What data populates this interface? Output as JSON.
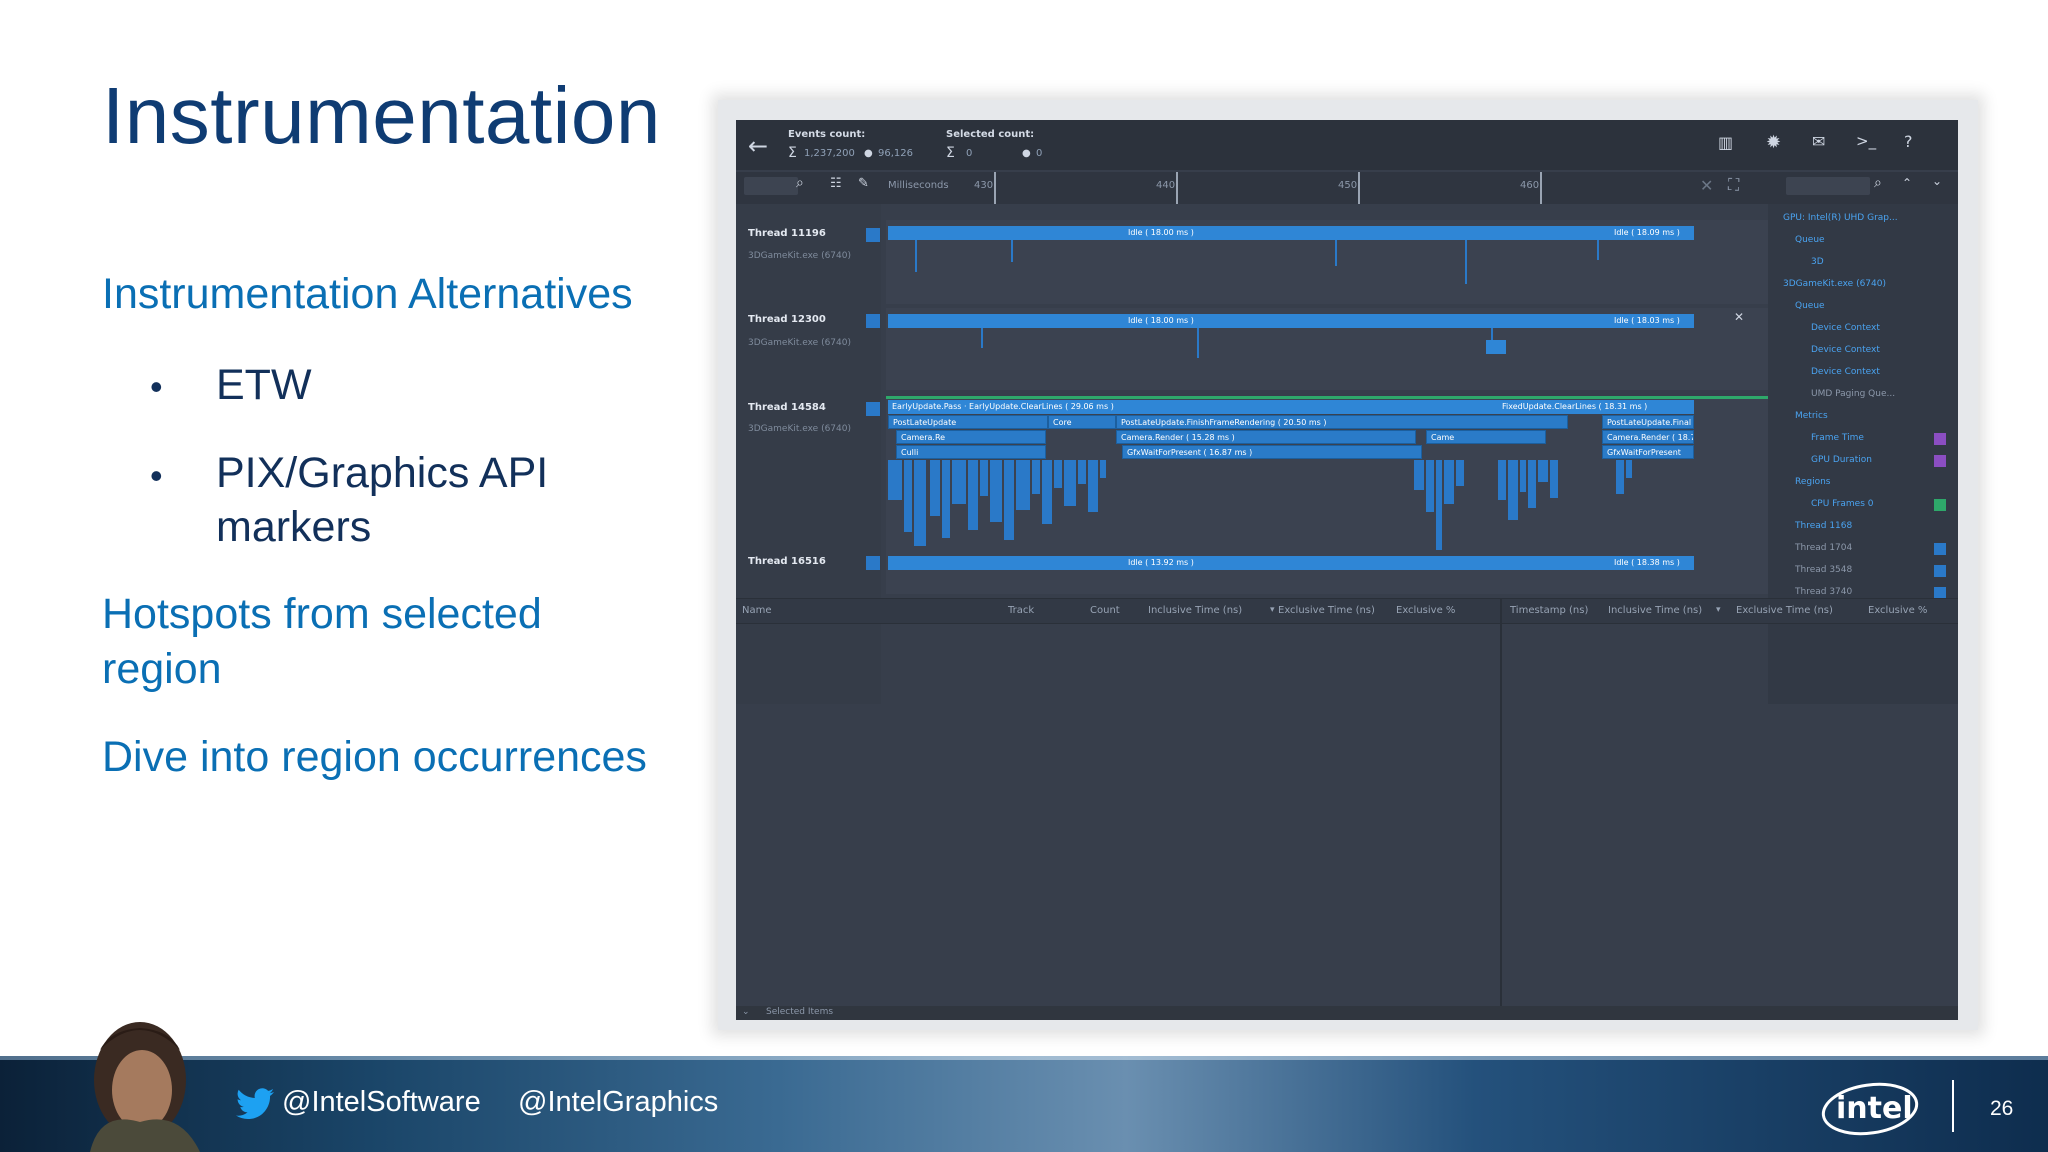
{
  "slide": {
    "title": "Instrumentation",
    "bullets": [
      {
        "text": "Instrumentation Alternatives"
      },
      {
        "text": "ETW",
        "level": 2
      },
      {
        "text": "PIX/Graphics API",
        "level": 2,
        "cont": "markers"
      },
      {
        "text": "Hotspots from selected"
      },
      {
        "text": "region"
      },
      {
        "text": "Dive into region occurrences"
      }
    ],
    "bullet_glyph": "•"
  },
  "app": {
    "toolbar": {
      "events_count_label": "Events count:",
      "events_count_value": "1,237,200",
      "events_hidden_value": "96,126",
      "selected_count_label": "Selected count:",
      "selected_count_value": "0",
      "selected_hidden_value": "0",
      "sigma": "Σ"
    },
    "ruler": {
      "unit_label": "Milliseconds",
      "ticks": [
        "430",
        "440",
        "450",
        "460"
      ]
    },
    "threads": [
      {
        "name": "Thread 11196",
        "process": "3DGameKit.exe (6740)",
        "bar_left": "Idle ( 18.00 ms )",
        "bar_right": "Idle ( 18.09 ms )"
      },
      {
        "name": "Thread 12300",
        "process": "3DGameKit.exe (6740)",
        "bar_left": "Idle ( 18.00 ms )",
        "bar_right": "Idle ( 18.03 ms )"
      },
      {
        "name": "Thread 14584",
        "process": "3DGameKit.exe (6740)",
        "bar_left": "EarlyUpdate.Pass · EarlyUpdate.ClearLines ( 29.06 ms )",
        "bar_right": "FixedUpdate.ClearLines ( 18.31 ms )",
        "sub1_a": "PostLateUpdate",
        "sub1_b": "Core",
        "sub1_c": "PostLateUpdate.FinishFrameRendering ( 20.50 ms )",
        "sub1_d": "PostLateUpdate.Final",
        "sub2_a": "Camera.Re",
        "sub2_b": "Camera.Render ( 15.28 ms )",
        "sub2_c": "Came",
        "sub2_d": "Camera.Render ( 18.7",
        "sub3_a": "Culli",
        "sub3_b": "GfxWaitForPresent ( 16.87 ms )",
        "sub3_c": "GfxWaitForPresent"
      },
      {
        "name": "Thread 16516",
        "process": "",
        "bar_left": "Idle ( 13.92 ms )",
        "bar_right": "Idle ( 18.38 ms )"
      }
    ],
    "tree": [
      {
        "label": "GPU: Intel(R) UHD Grap...",
        "indent": 0,
        "color": "#4aa3f0"
      },
      {
        "label": "Queue",
        "indent": 1,
        "color": "#4aa3f0"
      },
      {
        "label": "3D",
        "indent": 2,
        "color": "#4aa3f0"
      },
      {
        "label": "3DGameKit.exe (6740)",
        "indent": 0,
        "color": "#4aa3f0"
      },
      {
        "label": "Queue",
        "indent": 1,
        "color": "#4aa3f0"
      },
      {
        "label": "Device Context",
        "indent": 2,
        "color": "#4aa3f0"
      },
      {
        "label": "Device Context",
        "indent": 2,
        "color": "#4aa3f0"
      },
      {
        "label": "Device Context",
        "indent": 2,
        "color": "#4aa3f0"
      },
      {
        "label": "UMD Paging Que...",
        "indent": 2,
        "color": "#b9c3d1"
      },
      {
        "label": "Metrics",
        "indent": 1,
        "color": "#4aa3f0"
      },
      {
        "label": "Frame Time",
        "indent": 2,
        "color": "#4aa3f0",
        "swatch": "#8b4ec2"
      },
      {
        "label": "GPU Duration",
        "indent": 2,
        "color": "#4aa3f0",
        "swatch": "#8b4ec2"
      },
      {
        "label": "Regions",
        "indent": 1,
        "color": "#4aa3f0"
      },
      {
        "label": "CPU Frames 0",
        "indent": 2,
        "color": "#4aa3f0",
        "swatch": "#2ea86a"
      },
      {
        "label": "Thread 1168",
        "indent": 1,
        "color": "#4aa3f0"
      },
      {
        "label": "Thread 1704",
        "indent": 1,
        "color": "#8c98aa",
        "swatch": "#2a79c8"
      },
      {
        "label": "Thread 3548",
        "indent": 1,
        "color": "#8c98aa",
        "swatch": "#2a79c8"
      },
      {
        "label": "Thread 3740",
        "indent": 1,
        "color": "#8c98aa",
        "swatch": "#2a79c8"
      }
    ],
    "columns_left": [
      "Name",
      "Track",
      "Count",
      "Inclusive Time (ns)",
      "Exclusive Time (ns)",
      "Exclusive %"
    ],
    "columns_right": [
      "Timestamp (ns)",
      "Inclusive Time (ns)",
      "Exclusive Time (ns)",
      "Exclusive %"
    ],
    "status": "Selected Items"
  },
  "footer": {
    "handle1": "@IntelSoftware",
    "handle2": "@IntelGraphics",
    "logo": "intel",
    "page": "26"
  }
}
